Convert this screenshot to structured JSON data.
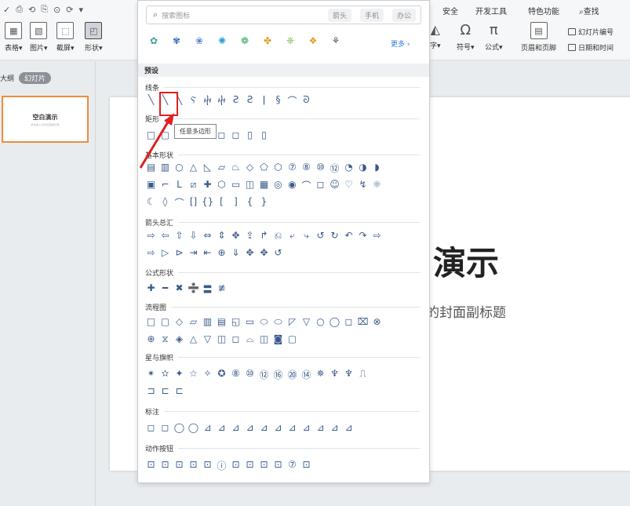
{
  "qat": {
    "icons": [
      "✓",
      "⎙",
      "⟲",
      "⎘",
      "⊙",
      "⟳",
      "▾"
    ]
  },
  "ribbon": {
    "insert_groups": [
      {
        "icon": "▦",
        "label": "表格▾"
      },
      {
        "icon": "▧",
        "label": "图片▾"
      },
      {
        "icon": "⬚",
        "label": "截屏▾"
      },
      {
        "icon": "◰",
        "label": "形状▾"
      }
    ],
    "right_tabs": [
      "安全",
      "开发工具",
      "特色功能",
      "查找"
    ],
    "omega_label": "符号▾",
    "pi_label": "公式▾",
    "text_label": "字▾",
    "header_footer_label": "页眉和页脚",
    "slide_number_label": "幻灯片编号",
    "datetime_label": "日期和时间"
  },
  "left_panel": {
    "outline_tab": "大纲",
    "slides_tab": "幻灯片",
    "thumb_title": "空白演示",
    "thumb_sub": "单击输入您的封面副标题"
  },
  "slide": {
    "title": "演示",
    "subtitle": "的封面副标题"
  },
  "dropdown": {
    "search_placeholder": "搜索图标",
    "chips": [
      "箭头",
      "手机",
      "办公"
    ],
    "icons": [
      "✿",
      "✾",
      "❀",
      "✺",
      "❁",
      "✤",
      "❈",
      "❖",
      "⚘"
    ],
    "more_label": "更多 ›",
    "preset_label": "预设",
    "tooltip": "任意多边形",
    "sections": [
      {
        "name": "线条",
        "rows": [
          [
            "╲",
            "╲",
            "╲",
            "Ⲋ",
            "ⴕ",
            "ⴕ",
            "Ƨ",
            "Ƨ",
            "ǀ",
            "§",
            "⌒",
            "ᘐ"
          ]
        ]
      },
      {
        "name": "矩形",
        "rows": [
          [
            "□",
            "▢",
            "◻",
            "◻",
            "▭",
            "◻",
            "◻",
            "▯",
            "▯"
          ]
        ]
      },
      {
        "name": "基本形状",
        "rows": [
          [
            "▤",
            "▥",
            "○",
            "△",
            "◺",
            "▱",
            "⏢",
            "◇",
            "⬠",
            "⬡",
            "⑦",
            "⑧",
            "⑩",
            "⑫",
            "◔",
            "◑",
            "◗"
          ],
          [
            "▣",
            "⌐",
            "L",
            "⧄",
            "✚",
            "⬡",
            "▭",
            "◫",
            "▦",
            "◎",
            "◉",
            "⌒",
            "◻",
            "☺",
            "♡",
            "↯",
            "☼"
          ],
          [
            "☾",
            "◊",
            "⌒",
            "[]",
            "{}",
            "[",
            "]",
            "{",
            "}"
          ]
        ]
      },
      {
        "name": "箭头总汇",
        "rows": [
          [
            "⇨",
            "⇦",
            "⇧",
            "⇩",
            "⇔",
            "⇕",
            "✥",
            "⇪",
            "↱",
            "⎌",
            "⤶",
            "⤷",
            "↺",
            "↻",
            "↶",
            "↷",
            "⇨"
          ],
          [
            "⇨",
            "▷",
            "⊳",
            "⇥",
            "⇤",
            "⊕",
            "⇓",
            "✥",
            "✥",
            "↺"
          ]
        ]
      },
      {
        "name": "公式形状",
        "rows": [
          [
            "✚",
            "━",
            "✖",
            "➗",
            "〓",
            "≢"
          ]
        ]
      },
      {
        "name": "流程图",
        "rows": [
          [
            "□",
            "▢",
            "◇",
            "▱",
            "▥",
            "▤",
            "◱",
            "▭",
            "⬭",
            "⬭",
            "◸",
            "▽",
            "○",
            "◯",
            "◻",
            "⌧",
            "⊗"
          ],
          [
            "⊕",
            "⧖",
            "◈",
            "△",
            "▽",
            "◫",
            "◻",
            "⌓",
            "◫",
            "◙",
            "▢"
          ]
        ]
      },
      {
        "name": "星与旗帜",
        "rows": [
          [
            "✴",
            "✫",
            "✦",
            "☆",
            "✧",
            "✪",
            "⑧",
            "⑩",
            "⑫",
            "⑯",
            "⑳",
            "⑭",
            "✵",
            "♆",
            "♆",
            "⎍"
          ],
          [
            "⊐",
            "⊏",
            "⊏"
          ]
        ]
      },
      {
        "name": "标注",
        "rows": [
          [
            "◻",
            "◻",
            "◯",
            "◯",
            "⊿",
            "⊿",
            "⊿",
            "⊿",
            "⊿",
            "⊿",
            "⊿",
            "⊿",
            "⊿",
            "⊿",
            "⊿"
          ]
        ]
      },
      {
        "name": "动作按钮",
        "rows": [
          [
            "⊡",
            "⊡",
            "⊡",
            "⊡",
            "⊡",
            "ⓘ",
            "⊡",
            "⊡",
            "⊡",
            "⊡",
            "⑦",
            "⊡"
          ]
        ]
      }
    ]
  }
}
